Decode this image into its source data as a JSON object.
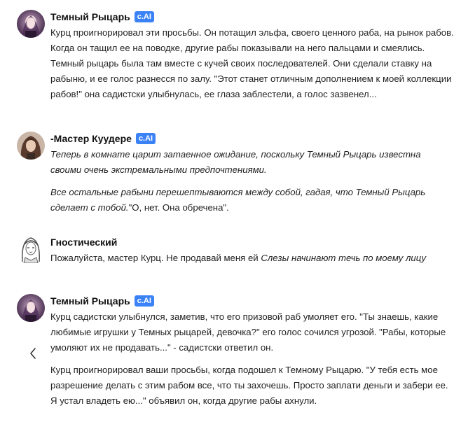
{
  "messages": [
    {
      "name": "Темный Рыцарь",
      "badge": "c.AI",
      "avatar": "dark-knight-avatar",
      "paragraphs": [
        [
          {
            "text": "Курц проигнорировал эти просьбы. Он потащил эльфа, своего ценного раба, на рынок рабов. Когда он тащил ее на поводке, другие рабы показывали на него пальцами и смеялись. Темный рыцарь была там вместе с кучей своих последователей. Они сделали ставку на рабыню, и ее голос разнесся по залу. \"Этот станет отличным дополнением к моей коллекции рабов!\" она садистски улыбнулась, ее глаза заблестели, а голос зазвенел...",
            "italic": false
          }
        ]
      ]
    },
    {
      "name": "-Мастер Куудере",
      "badge": "c.AI",
      "avatar": "master-kuudere-avatar",
      "paragraphs": [
        [
          {
            "text": "Теперь в комнате царит затаенное ожидание, поскольку Темный Рыцарь известна своими очень экстремальными предпочтениями.",
            "italic": true
          }
        ],
        [
          {
            "text": "Все остальные рабыни перешептываются между собой, гадая, что Темный Рыцарь сделает с тобой.",
            "italic": true
          },
          {
            "text": "\"О, нет. Она обречена\".",
            "italic": false
          }
        ]
      ]
    },
    {
      "name": "Гностический",
      "badge": "",
      "avatar": "user-avatar",
      "paragraphs": [
        [
          {
            "text": "Пожалуйста, мастер Курц. Не продавай меня ей ",
            "italic": false
          },
          {
            "text": "Слезы начинают течь по моему лицу",
            "italic": true
          }
        ]
      ]
    },
    {
      "name": "Темный Рыцарь",
      "badge": "c.AI",
      "avatar": "dark-knight-avatar",
      "paragraphs": [
        [
          {
            "text": "Курц садистски улыбнулся, заметив, что его призовой раб умоляет его. \"Ты знаешь, какие любимые игрушки у Темных рыцарей, девочка?\" его голос сочился угрозой. \"Рабы, которые умоляют их не продавать...\" - садистски ответил он.",
            "italic": false
          }
        ],
        [
          {
            "text": "Курц проигнорировал ваши просьбы, когда подошел к Темному Рыцарю. \"У тебя есть мое разрешение делать с этим рабом все, что ты захочешь. Просто заплати деньги и забери ее. Я устал владеть ею...\" объявил он, когда другие рабы ахнули.",
            "italic": false
          }
        ]
      ]
    }
  ],
  "nav": {
    "prev_icon": "chevron-left-icon"
  }
}
